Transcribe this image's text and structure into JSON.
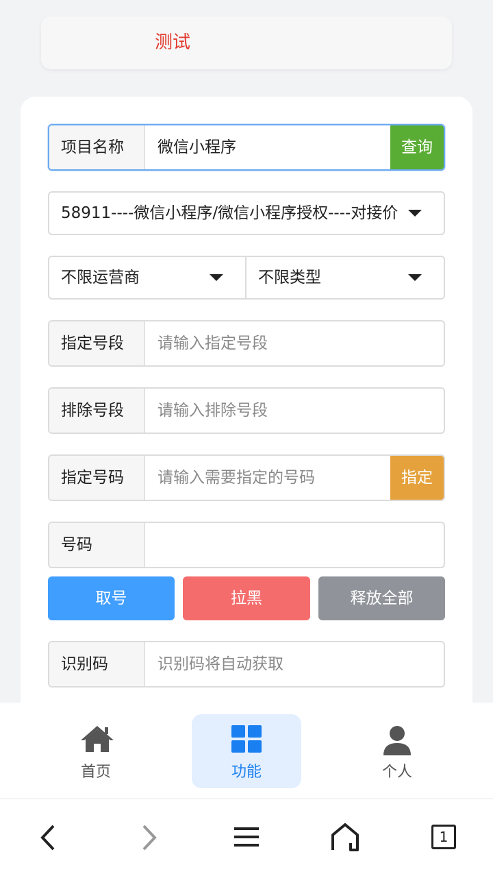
{
  "header": {
    "title": "测试"
  },
  "project": {
    "label": "项目名称",
    "value": "微信小程序",
    "query_button": "查询"
  },
  "project_select": {
    "value": "58911----微信小程序/微信小程序授权----对接价"
  },
  "operator_select": {
    "value": "不限运营商"
  },
  "type_select": {
    "value": "不限类型"
  },
  "prefix": {
    "label": "指定号段",
    "placeholder": "请输入指定号段"
  },
  "exclude": {
    "label": "排除号段",
    "placeholder": "请输入排除号段"
  },
  "specify": {
    "label": "指定号码",
    "placeholder": "请输入需要指定的号码",
    "button": "指定"
  },
  "number": {
    "label": "号码",
    "value": ""
  },
  "actions": {
    "get": "取号",
    "block": "拉黑",
    "release_all": "释放全部"
  },
  "code": {
    "label": "识别码",
    "placeholder": "识别码将自动获取"
  },
  "tabs": [
    {
      "label": "首页",
      "icon": "home-icon"
    },
    {
      "label": "功能",
      "icon": "grid-icon",
      "active": true
    },
    {
      "label": "个人",
      "icon": "user-icon"
    }
  ],
  "colors": {
    "accent": "#1a7ff0",
    "title_red": "#e23b2e",
    "query_green": "#5aad34",
    "specify_orange": "#e5a23c",
    "get_blue": "#409eff",
    "block_red": "#f56c6c",
    "release_gray": "#909399"
  },
  "browser_nav": {
    "tab_count": "1"
  }
}
